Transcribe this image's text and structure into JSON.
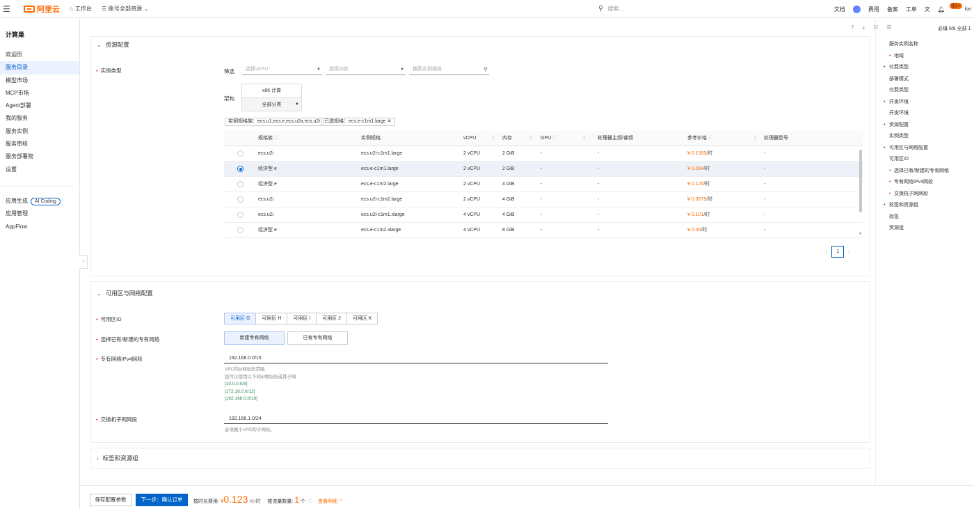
{
  "topbar": {
    "brand": "阿里云",
    "workbench": "工作台",
    "account_scope": "账号全部资源",
    "search_placeholder": "搜索...",
    "right_items": [
      "文档",
      "费用",
      "备案",
      "工单"
    ],
    "badge": "99+",
    "user": "lon"
  },
  "sidebar": {
    "title": "计算巢",
    "items": [
      "欢迎页",
      "服务目录",
      "模型市场",
      "MCP市场",
      "Agent部署",
      "我的服务",
      "服务实例",
      "服务审核",
      "服务部署物",
      "设置"
    ],
    "active_index": 1,
    "items2": [
      "应用生成",
      "应用管理",
      "AppFlow"
    ],
    "ai_pill": "AI Coding"
  },
  "resource_section": {
    "title": "资源配置",
    "instance_type_label": "实例类型",
    "filter_label": "筛选",
    "vcpu_placeholder": "选择vCPU",
    "memory_placeholder": "选择内存",
    "spec_search_placeholder": "搜索实例规格",
    "arch_label": "架构",
    "arch_value": "x86 计算",
    "arch_category": "全部分类",
    "family_tag": "实例规格族：ecs.u1,ecs.e,ecs.u2a,ecs.u2i",
    "selected_tag": "已选规格：ecs.e-c1m1.large",
    "columns": [
      "规格族",
      "实例规格",
      "vCPU",
      "内存",
      "GPU",
      "处理器主频/睿频",
      "参考价格",
      "处理器型号"
    ],
    "rows": [
      {
        "family": "ecs.u2i",
        "spec": "ecs.u2i-c1m1.large",
        "vcpu": "2 vCPU",
        "mem": "2 GiB",
        "gpu": "-",
        "freq": "-",
        "price": "¥ 0.1505",
        "unit": "/时",
        "cpu": "-"
      },
      {
        "family": "经济型 e",
        "spec": "ecs.e-c1m1.large",
        "vcpu": "2 vCPU",
        "mem": "2 GiB",
        "gpu": "-",
        "freq": "-",
        "price": "¥ 0.094",
        "unit": "/时",
        "cpu": "-"
      },
      {
        "family": "经济型 e",
        "spec": "ecs.e-c1m2.large",
        "vcpu": "2 vCPU",
        "mem": "4 GiB",
        "gpu": "-",
        "freq": "-",
        "price": "¥ 0.125",
        "unit": "/时",
        "cpu": "-"
      },
      {
        "family": "ecs.u2i",
        "spec": "ecs.u2i-c1m2.large",
        "vcpu": "2 vCPU",
        "mem": "4 GiB",
        "gpu": "-",
        "freq": "-",
        "price": "¥ 0.3679",
        "unit": "/时",
        "cpu": "-"
      },
      {
        "family": "ecs.u2i",
        "spec": "ecs.u2i-c1m1.xlarge",
        "vcpu": "4 vCPU",
        "mem": "4 GiB",
        "gpu": "-",
        "freq": "-",
        "price": "¥ 0.101",
        "unit": "/时",
        "cpu": "-"
      },
      {
        "family": "经济型 e",
        "spec": "ecs.e-c1m2.xlarge",
        "vcpu": "4 vCPU",
        "mem": "8 GiB",
        "gpu": "-",
        "freq": "-",
        "price": "¥ 0.45",
        "unit": "/时",
        "cpu": "-"
      }
    ],
    "selected_row": 1,
    "page": "1"
  },
  "zone_section": {
    "title": "可用区与网络配置",
    "zone_label": "可用区ID",
    "zones": [
      "可用区 G",
      "可用区 H",
      "可用区 I",
      "可用区 J",
      "可用区 K"
    ],
    "vpc_label": "选择已有/新建的专有网络",
    "vpc_options": [
      "新建专有网络",
      "已有专有网络"
    ],
    "cidr_label": "专有网络IPv4网段",
    "cidr_value": "192.168.0.0/16",
    "cidr_help": [
      "VPC的ip地址段范围,",
      "您可以使用以下的ip地址段或其子网:",
      "[10.0.0.0/8]",
      "[172.16.0.0/12]",
      "[192.168.0.0/16]"
    ],
    "vsw_label": "交换机子网网段",
    "vsw_value": "192.168.1.0/24",
    "vsw_help": "必须属于VPC的子网段。"
  },
  "tags_section": {
    "title": "标签和资源组"
  },
  "right_nav": {
    "top": "必填 6/6  全部 1",
    "items": [
      {
        "t": "服务实例名称",
        "k": "plain"
      },
      {
        "t": "地域",
        "k": "red"
      },
      {
        "t": "付费类型",
        "k": "dot"
      },
      {
        "t": "部署模式",
        "k": "plain"
      },
      {
        "t": "付费类型",
        "k": "plain"
      },
      {
        "t": "开发环境",
        "k": "dot"
      },
      {
        "t": "开发环境",
        "k": "plain"
      },
      {
        "t": "资源配置",
        "k": "dot"
      },
      {
        "t": "实例类型",
        "k": "plain"
      },
      {
        "t": "可用区与网络配置",
        "k": "dot"
      },
      {
        "t": "可用区ID",
        "k": "plain"
      },
      {
        "t": "选择已有/新建的专有网络",
        "k": "red"
      },
      {
        "t": "专有网络IPv4网段",
        "k": "red"
      },
      {
        "t": "交换机子网网段",
        "k": "red"
      },
      {
        "t": "标签和资源组",
        "k": "dot"
      },
      {
        "t": "标签",
        "k": "plain"
      },
      {
        "t": "资源组",
        "k": "plain"
      }
    ]
  },
  "bottom": {
    "save_label": "保存配置参数",
    "next_label": "下一步：确认订单",
    "hourly_label": "按时长费用:",
    "currency": "¥",
    "price": "0.123",
    "price_unit": "/小时",
    "usage_label": "按流量数量:",
    "count": "1",
    "count_unit": "个",
    "detail_link": "查看明细"
  }
}
